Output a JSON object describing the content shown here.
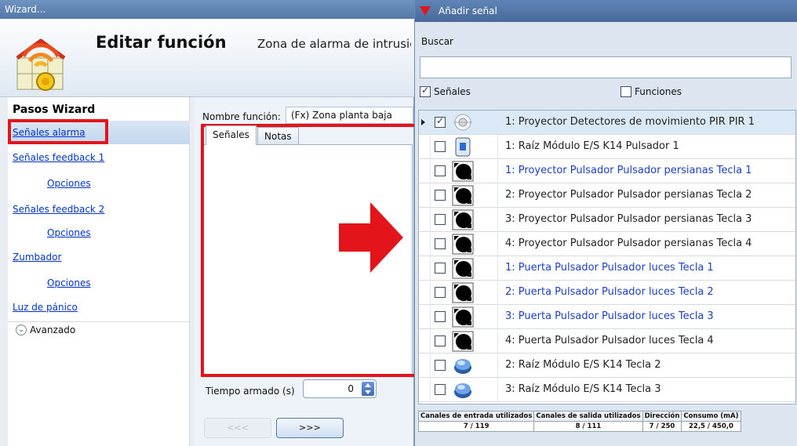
{
  "wizard": {
    "window_title": "Wizard...",
    "header_title": "Editar función",
    "header_subtitle": "Zona de alarma de intrusión",
    "steps_title": "Pasos Wizard",
    "steps": [
      {
        "label": "Señales alarma",
        "selected": true
      },
      {
        "label": "Señales feedback 1"
      },
      {
        "label": "Opciones"
      },
      {
        "label": "Señales feedback 2"
      },
      {
        "label": "Opciones"
      },
      {
        "label": "Zumbador"
      },
      {
        "label": "Opciones"
      },
      {
        "label": "Luz de pánico"
      }
    ],
    "advanced_label": "Avanzado",
    "function_name_label": "Nombre función:",
    "function_name_value": "(Fx) Zona planta baja",
    "tabs": [
      "Señales",
      "Notas"
    ],
    "armed_time_label": "Tiempo armado (s)",
    "armed_time_value": "0",
    "prev_button": "<<<",
    "next_button": ">>>"
  },
  "add_signal": {
    "title": "Añadir señal",
    "search_label": "Buscar",
    "search_value": "",
    "filter_signals": {
      "label": "Señales",
      "checked": true
    },
    "filter_functions": {
      "label": "Funciones",
      "checked": false
    },
    "rows": [
      {
        "text": "1: Proyector Detectores de movimiento PIR PIR 1",
        "icon": "pir-sensor-icon",
        "checked": true,
        "selected": true,
        "blue": false
      },
      {
        "text": "1: Raíz Módulo E/S K14 Pulsador 1",
        "icon": "io-module-icon",
        "checked": false,
        "blue": false
      },
      {
        "text": "1: Proyector Pulsador Pulsador persianas Tecla 1",
        "icon": "pushbutton-icon",
        "checked": false,
        "blue": true
      },
      {
        "text": "2: Proyector Pulsador Pulsador persianas Tecla 2",
        "icon": "pushbutton-icon",
        "checked": false,
        "blue": false
      },
      {
        "text": "3: Proyector Pulsador Pulsador persianas Tecla 3",
        "icon": "pushbutton-icon",
        "checked": false,
        "blue": false
      },
      {
        "text": "4: Proyector Pulsador Pulsador persianas Tecla 4",
        "icon": "pushbutton-icon",
        "checked": false,
        "blue": false
      },
      {
        "text": "1: Puerta Pulsador Pulsador luces Tecla 1",
        "icon": "pushbutton-icon",
        "checked": false,
        "blue": true
      },
      {
        "text": "2: Puerta Pulsador Pulsador luces Tecla 2",
        "icon": "pushbutton-icon",
        "checked": false,
        "blue": true
      },
      {
        "text": "3: Puerta Pulsador Pulsador luces Tecla 3",
        "icon": "pushbutton-icon",
        "checked": false,
        "blue": true
      },
      {
        "text": "4: Puerta Pulsador Pulsador luces Tecla 4",
        "icon": "pushbutton-icon",
        "checked": false,
        "blue": false
      },
      {
        "text": "2: Raíz Módulo E/S K14 Tecla 2",
        "icon": "round-button-icon",
        "checked": false,
        "blue": false
      },
      {
        "text": "3: Raíz Módulo E/S K14 Tecla 3",
        "icon": "round-button-icon",
        "checked": false,
        "blue": false
      }
    ],
    "stats": {
      "headers": [
        "Canales de entrada utilizados",
        "Canales de salida utilizados",
        "Dirección",
        "Consumo (mA)"
      ],
      "values": [
        "7 / 119",
        "8 / 111",
        "7 / 250",
        "22,5 / 450,0"
      ]
    }
  },
  "colors": {
    "highlight_red": "#e4141b",
    "link_blue": "#0033cc",
    "title_bar": "#5479a8"
  }
}
